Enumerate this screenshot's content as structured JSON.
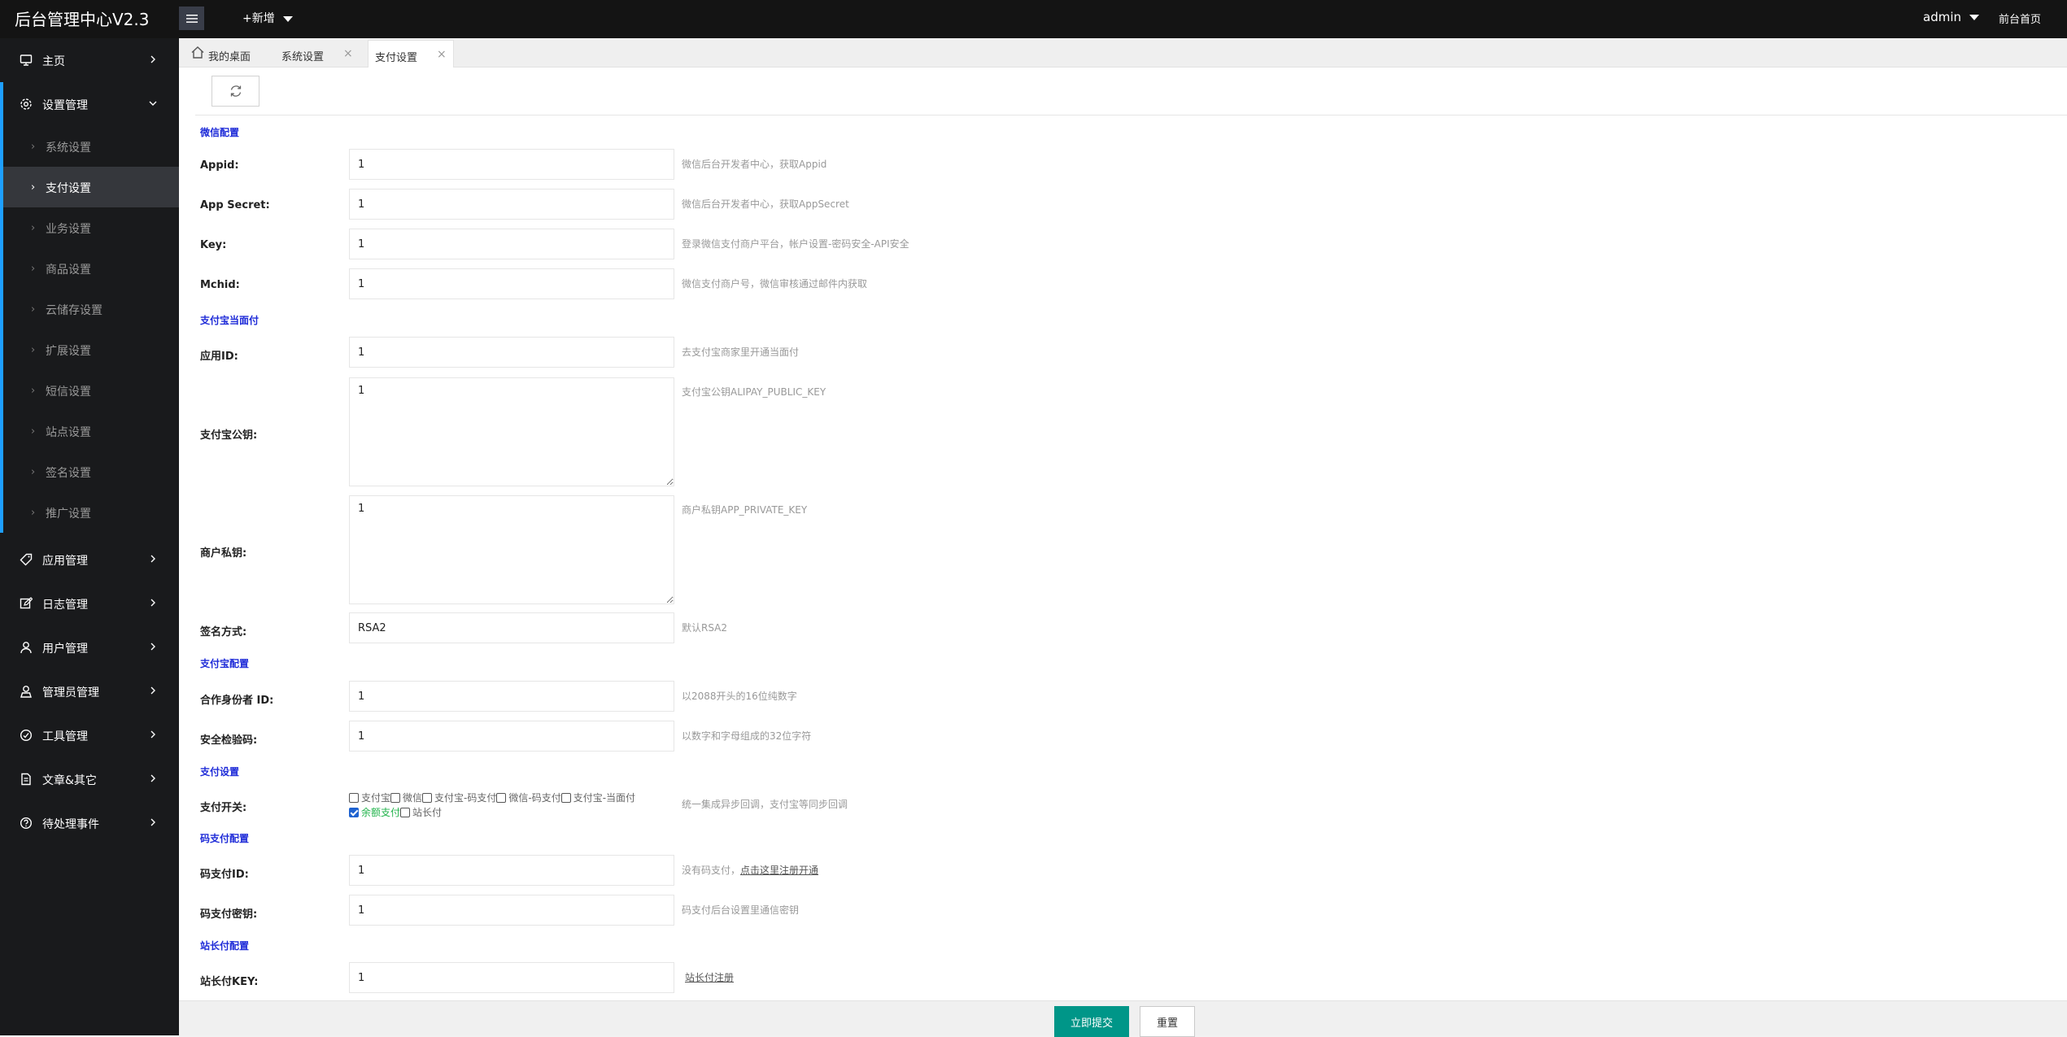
{
  "header": {
    "logo": "后台管理中心V2.3",
    "add_new": "+新增",
    "user": "admin",
    "front_link": "前台首页"
  },
  "sidebar": {
    "items": [
      {
        "label": "主页",
        "icon": "monitor-icon"
      },
      {
        "label": "设置管理",
        "icon": "gear-icon"
      },
      {
        "label": "应用管理",
        "icon": "tag-icon"
      },
      {
        "label": "日志管理",
        "icon": "edit-icon"
      },
      {
        "label": "用户管理",
        "icon": "user-icon"
      },
      {
        "label": "管理员管理",
        "icon": "admin-icon"
      },
      {
        "label": "工具管理",
        "icon": "tools-icon"
      },
      {
        "label": "文章&其它",
        "icon": "document-icon"
      },
      {
        "label": "待处理事件",
        "icon": "help-icon"
      }
    ],
    "sub_items": [
      {
        "label": "系统设置"
      },
      {
        "label": "支付设置"
      },
      {
        "label": "业务设置"
      },
      {
        "label": "商品设置"
      },
      {
        "label": "云储存设置"
      },
      {
        "label": "扩展设置"
      },
      {
        "label": "短信设置"
      },
      {
        "label": "站点设置"
      },
      {
        "label": "签名设置"
      },
      {
        "label": "推广设置"
      }
    ]
  },
  "tabs": [
    {
      "label": "我的桌面"
    },
    {
      "label": "系统设置",
      "close": "×"
    },
    {
      "label": "支付设置",
      "close": "×"
    }
  ],
  "form": {
    "sections": {
      "wechat": "微信配置",
      "alipay_f2f": "支付宝当面付",
      "alipay": "支付宝配置",
      "payment": "支付设置",
      "codepay": "码支付配置",
      "zzf": "站长付配置"
    },
    "appid": {
      "label": "Appid:",
      "value": "1",
      "hint": "微信后台开发者中心，获取Appid"
    },
    "app_secret": {
      "label": "App Secret:",
      "value": "1",
      "hint": "微信后台开发者中心，获取AppSecret"
    },
    "key": {
      "label": "Key:",
      "value": "1",
      "hint": "登录微信支付商户平台，帐户设置-密码安全-API安全"
    },
    "mchid": {
      "label": "Mchid:",
      "value": "1",
      "hint": "微信支付商户号，微信审核通过邮件内获取"
    },
    "app_id": {
      "label": "应用ID:",
      "value": "1",
      "hint": "去支付宝商家里开通当面付"
    },
    "alipay_public_key": {
      "label": "支付宝公钥:",
      "value": "1",
      "hint": "支付宝公钥ALIPAY_PUBLIC_KEY"
    },
    "merchant_private_key": {
      "label": "商户私钥:",
      "value": "1",
      "hint": "商户私钥APP_PRIVATE_KEY"
    },
    "sign_type": {
      "label": "签名方式:",
      "value": "RSA2",
      "hint": "默认RSA2"
    },
    "partner_id": {
      "label": "合作身份者 ID:",
      "value": "1",
      "hint": "以2088开头的16位纯数字"
    },
    "security_code": {
      "label": "安全检验码:",
      "value": "1",
      "hint": "以数字和字母组成的32位字符"
    },
    "pay_switch": {
      "label": "支付开关:",
      "hint": "统一集成异步回调，支付宝等同步回调",
      "options": [
        {
          "label": "支付宝",
          "checked": false
        },
        {
          "label": "微信",
          "checked": false
        },
        {
          "label": "支付宝-码支付",
          "checked": false
        },
        {
          "label": "微信-码支付",
          "checked": false
        },
        {
          "label": "支付宝-当面付",
          "checked": false
        },
        {
          "label": "余额支付",
          "checked": true
        },
        {
          "label": "站长付",
          "checked": false
        }
      ]
    },
    "codepay_id": {
      "label": "码支付ID:",
      "value": "1",
      "hint": "没有码支付，",
      "hint_link": "点击这里注册开通"
    },
    "codepay_key": {
      "label": "码支付密钥:",
      "value": "1",
      "hint": "码支付后台设置里通信密钥"
    },
    "zzf_key": {
      "label": "站长付KEY:",
      "value": "1",
      "hint_link": "站长付注册"
    }
  },
  "footer": {
    "submit": "立即提交",
    "reset": "重置"
  },
  "colors": {
    "accent": "#009688",
    "sidebar_bg": "#191a1c",
    "header_bg": "#141414",
    "sidebar_active_bar": "#1e9fff",
    "section_title": "#1e2bd8"
  }
}
